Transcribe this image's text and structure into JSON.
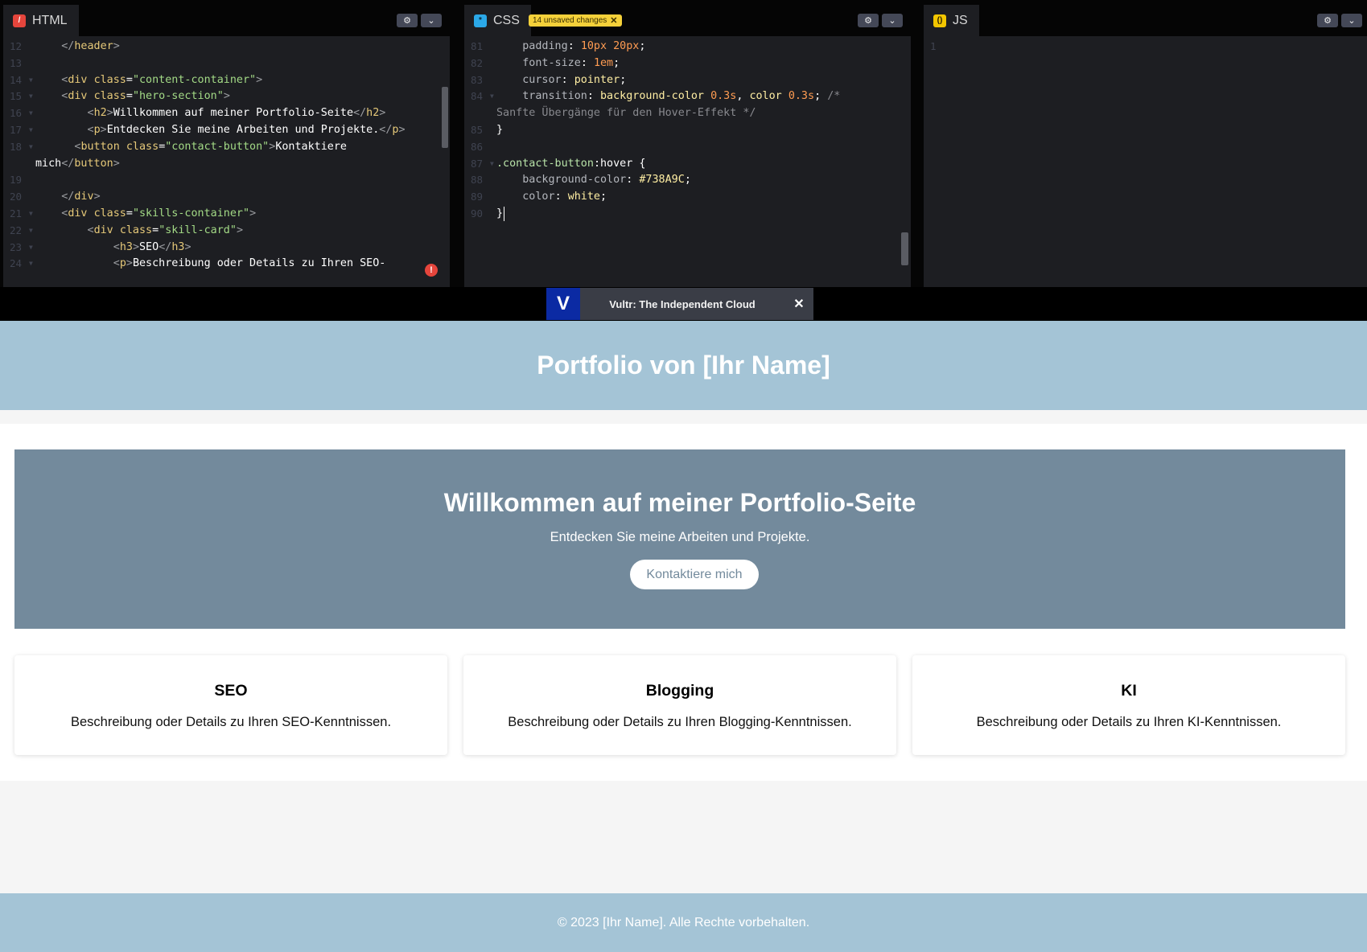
{
  "editors": {
    "html": {
      "tab_label": "HTML",
      "lines": [
        {
          "n": "12",
          "fold": false,
          "indent": 0,
          "parts": [
            [
              "tag",
              "    </"
            ],
            [
              "tn",
              "header"
            ],
            [
              "tag",
              ">"
            ]
          ]
        },
        {
          "n": "13",
          "fold": false,
          "indent": 0,
          "parts": []
        },
        {
          "n": "14",
          "fold": true,
          "indent": 0,
          "parts": [
            [
              "tag",
              "    <"
            ],
            [
              "tn",
              "div "
            ],
            [
              "at",
              "class"
            ],
            [
              "pu",
              "="
            ],
            [
              "st",
              "\"content-container\""
            ],
            [
              "tag",
              ">"
            ]
          ]
        },
        {
          "n": "15",
          "fold": true,
          "indent": 0,
          "parts": [
            [
              "tag",
              "    <"
            ],
            [
              "tn",
              "div "
            ],
            [
              "at",
              "class"
            ],
            [
              "pu",
              "="
            ],
            [
              "st",
              "\"hero-section\""
            ],
            [
              "tag",
              ">"
            ]
          ]
        },
        {
          "n": "16",
          "fold": true,
          "indent": 0,
          "parts": [
            [
              "tag",
              "        <"
            ],
            [
              "tn",
              "h2"
            ],
            [
              "tag",
              ">"
            ],
            [
              "pu",
              "Willkommen auf meiner Portfolio-Seite"
            ],
            [
              "tag",
              "</"
            ],
            [
              "tn",
              "h2"
            ],
            [
              "tag",
              ">"
            ]
          ]
        },
        {
          "n": "17",
          "fold": true,
          "indent": 0,
          "parts": [
            [
              "tag",
              "        <"
            ],
            [
              "tn",
              "p"
            ],
            [
              "tag",
              ">"
            ],
            [
              "pu",
              "Entdecken Sie meine Arbeiten und Projekte."
            ],
            [
              "tag",
              "</"
            ],
            [
              "tn",
              "p"
            ],
            [
              "tag",
              ">"
            ]
          ]
        },
        {
          "n": "18",
          "fold": true,
          "indent": 0,
          "parts": [
            [
              "tag",
              "      <"
            ],
            [
              "tn",
              "button "
            ],
            [
              "at",
              "class"
            ],
            [
              "pu",
              "="
            ],
            [
              "st",
              "\"contact-button\""
            ],
            [
              "tag",
              ">"
            ],
            [
              "pu",
              "Kontaktiere"
            ]
          ]
        },
        {
          "n": "",
          "fold": false,
          "indent": 0,
          "parts": [
            [
              "pu",
              "mich"
            ],
            [
              "tag",
              "</"
            ],
            [
              "tn",
              "button"
            ],
            [
              "tag",
              ">"
            ]
          ]
        },
        {
          "n": "19",
          "fold": false,
          "indent": 0,
          "parts": []
        },
        {
          "n": "20",
          "fold": false,
          "indent": 0,
          "parts": [
            [
              "tag",
              "    </"
            ],
            [
              "tn",
              "div"
            ],
            [
              "tag",
              ">"
            ]
          ]
        },
        {
          "n": "21",
          "fold": true,
          "indent": 0,
          "parts": [
            [
              "tag",
              "    <"
            ],
            [
              "tn",
              "div "
            ],
            [
              "at",
              "class"
            ],
            [
              "pu",
              "="
            ],
            [
              "st",
              "\"skills-container\""
            ],
            [
              "tag",
              ">"
            ]
          ]
        },
        {
          "n": "22",
          "fold": true,
          "indent": 0,
          "parts": [
            [
              "tag",
              "        <"
            ],
            [
              "tn",
              "div "
            ],
            [
              "at",
              "class"
            ],
            [
              "pu",
              "="
            ],
            [
              "st",
              "\"skill-card\""
            ],
            [
              "tag",
              ">"
            ]
          ]
        },
        {
          "n": "23",
          "fold": true,
          "indent": 0,
          "parts": [
            [
              "tag",
              "            <"
            ],
            [
              "tn",
              "h3"
            ],
            [
              "tag",
              ">"
            ],
            [
              "pu",
              "SEO"
            ],
            [
              "tag",
              "</"
            ],
            [
              "tn",
              "h3"
            ],
            [
              "tag",
              ">"
            ]
          ]
        },
        {
          "n": "24",
          "fold": true,
          "indent": 0,
          "parts": [
            [
              "tag",
              "            <"
            ],
            [
              "tn",
              "p"
            ],
            [
              "tag",
              ">"
            ],
            [
              "pu",
              "Beschreibung oder Details zu Ihren SEO-"
            ]
          ]
        }
      ]
    },
    "css": {
      "tab_label": "CSS",
      "badge": "14 unsaved changes",
      "lines": [
        {
          "n": "81",
          "fold": false,
          "parts": [
            [
              "pr",
              "    padding"
            ],
            [
              "pu",
              ": "
            ],
            [
              "vl",
              "10px 20px"
            ],
            [
              "pu",
              ";"
            ]
          ]
        },
        {
          "n": "82",
          "fold": false,
          "parts": [
            [
              "pr",
              "    font-size"
            ],
            [
              "pu",
              ": "
            ],
            [
              "vl",
              "1em"
            ],
            [
              "pu",
              ";"
            ]
          ]
        },
        {
          "n": "83",
          "fold": false,
          "parts": [
            [
              "pr",
              "    cursor"
            ],
            [
              "pu",
              ": "
            ],
            [
              "kw",
              "pointer"
            ],
            [
              "pu",
              ";"
            ]
          ]
        },
        {
          "n": "84",
          "fold": true,
          "parts": [
            [
              "pr",
              "    transition"
            ],
            [
              "pu",
              ": "
            ],
            [
              "kw",
              "background-color "
            ],
            [
              "vl",
              "0.3s"
            ],
            [
              "pu",
              ", "
            ],
            [
              "kw",
              "color "
            ],
            [
              "vl",
              "0.3s"
            ],
            [
              "pu",
              "; "
            ],
            [
              "cm",
              "/*"
            ]
          ]
        },
        {
          "n": "",
          "fold": false,
          "parts": [
            [
              "cm",
              "Sanfte Übergänge für den Hover-Effekt */"
            ]
          ]
        },
        {
          "n": "85",
          "fold": false,
          "parts": [
            [
              "pu",
              "}"
            ]
          ]
        },
        {
          "n": "86",
          "fold": false,
          "parts": []
        },
        {
          "n": "87",
          "fold": true,
          "parts": [
            [
              "sel",
              ".contact-button"
            ],
            [
              "pu",
              ":hover {"
            ]
          ]
        },
        {
          "n": "88",
          "fold": false,
          "parts": [
            [
              "pr",
              "    background-color"
            ],
            [
              "pu",
              ": "
            ],
            [
              "kw",
              "#738A9C"
            ],
            [
              "pu",
              ";"
            ]
          ]
        },
        {
          "n": "89",
          "fold": false,
          "parts": [
            [
              "pr",
              "    color"
            ],
            [
              "pu",
              ": "
            ],
            [
              "kw",
              "white"
            ],
            [
              "pu",
              ";"
            ]
          ]
        },
        {
          "n": "90",
          "fold": false,
          "parts": [
            [
              "pu",
              "}"
            ]
          ]
        }
      ]
    },
    "js": {
      "tab_label": "JS",
      "lines": [
        {
          "n": "1",
          "fold": false,
          "parts": []
        }
      ]
    }
  },
  "ad": {
    "logo": "V",
    "text": "Vultr: The Independent Cloud",
    "close": "✕"
  },
  "preview": {
    "header_title": "Portfolio von [Ihr Name]",
    "hero": {
      "title": "Willkommen auf meiner Portfolio-Seite",
      "subtitle": "Entdecken Sie meine Arbeiten und Projekte.",
      "button": "Kontaktiere mich"
    },
    "skills": [
      {
        "title": "SEO",
        "text": "Beschreibung oder Details zu Ihren SEO-Kenntnissen."
      },
      {
        "title": "Blogging",
        "text": "Beschreibung oder Details zu Ihren Blogging-Kenntnissen."
      },
      {
        "title": "KI",
        "text": "Beschreibung oder Details zu Ihren KI-Kenntnissen."
      }
    ],
    "footer": "© 2023 [Ihr Name]. Alle Rechte vorbehalten."
  },
  "colors": {
    "header_bg": "#a4c4d6",
    "hero_bg": "#738a9c",
    "editor_bg": "#1d1e22",
    "badge_bg": "#f5d13a"
  },
  "icons": {
    "settings": "gear-icon",
    "collapse": "chevron-down-icon",
    "error": "error-icon"
  }
}
